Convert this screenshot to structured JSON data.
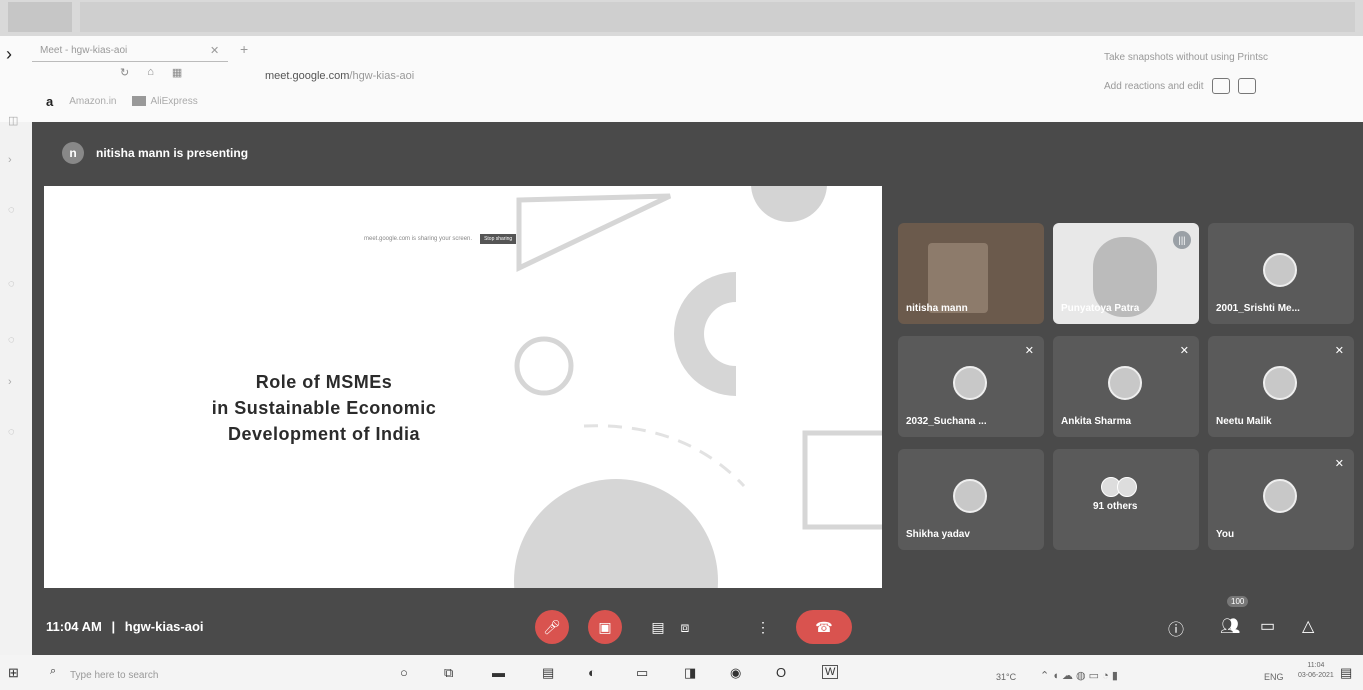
{
  "browser": {
    "tab_title": "Meet - hgw-kias-aoi",
    "url_host": "meet.google.com",
    "url_path": "/hgw-kias-aoi",
    "bookmarks": [
      "a",
      "Amazon.in",
      "AliExpress"
    ],
    "snip_hint_1": "Take snapshots without using Printsc",
    "snip_hint_2": "Add reactions and edit"
  },
  "meet": {
    "presenter_initial": "n",
    "presenting_text": "nitisha mann is presenting",
    "slide": {
      "title_lines": [
        "Role of MSMEs",
        "in Sustainable  Economic",
        "Development of India"
      ],
      "share_note": "meet.google.com is sharing your screen.",
      "stop_label": "Stop sharing"
    },
    "tiles": [
      {
        "name": "nitisha mann",
        "state": "video",
        "mic_off": false
      },
      {
        "name": "Punyatoya Patra",
        "state": "video-light",
        "mic_off": false,
        "speaking": true
      },
      {
        "name": "2001_Srishti Me...",
        "state": "avatar",
        "mic_off": false
      },
      {
        "name": "2032_Suchana ...",
        "state": "avatar",
        "mic_off": true
      },
      {
        "name": "Ankita Sharma",
        "state": "avatar",
        "mic_off": true
      },
      {
        "name": "Neetu Malik",
        "state": "avatar",
        "mic_off": true
      },
      {
        "name": "Shikha yadav",
        "state": "avatar",
        "mic_off": false
      },
      {
        "name": "91 others",
        "state": "others",
        "mic_off": false
      },
      {
        "name": "You",
        "state": "avatar",
        "mic_off": true
      }
    ],
    "time": "11:04 AM",
    "separator": "|",
    "meeting_code": "hgw-kias-aoi",
    "participants_count": "100",
    "colors": {
      "end_call": "#d9534f",
      "tile_bg": "#5a5a5a",
      "meet_bg": "#4a4a4a"
    }
  },
  "taskbar": {
    "search_placeholder": "Type here to search",
    "temperature": "31°C",
    "language": "ENG",
    "clock_time": "11:04",
    "clock_date": "03-06-2021"
  }
}
